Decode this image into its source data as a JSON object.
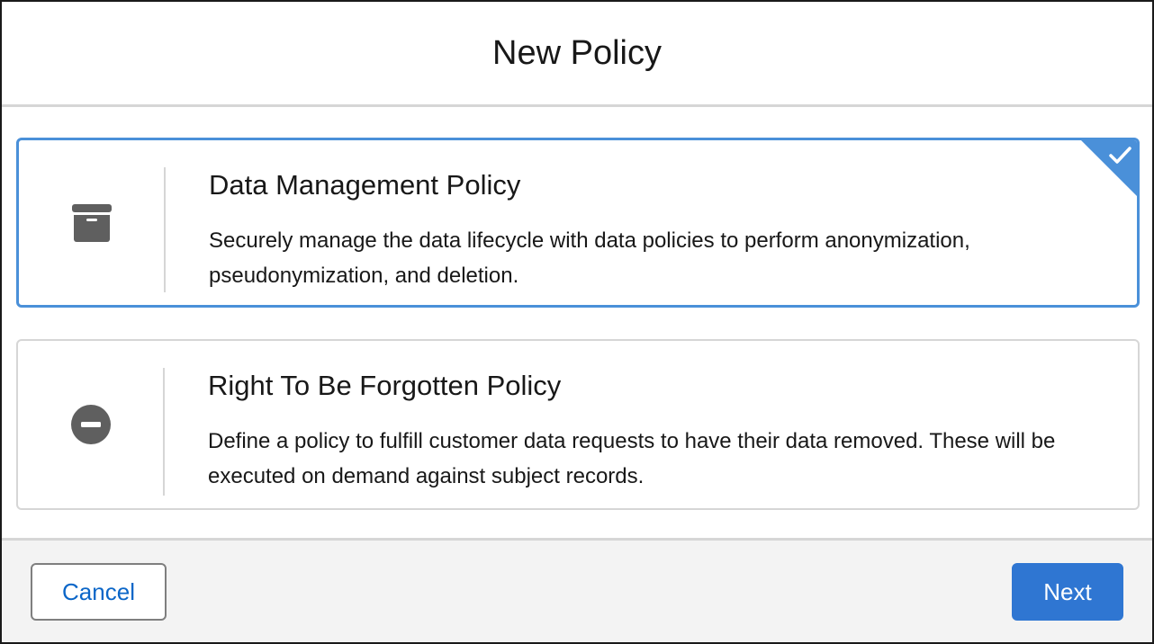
{
  "header": {
    "title": "New Policy"
  },
  "cards": [
    {
      "title": "Data Management Policy",
      "description": "Securely manage the data lifecycle with data policies to perform anonymization, pseudonymization, and deletion.",
      "icon": "archive-box-icon",
      "selected": true
    },
    {
      "title": "Right To Be Forgotten Policy",
      "description": "Define a policy to fulfill customer data requests to have their data removed. These will be executed on demand against subject records.",
      "icon": "minus-circle-icon",
      "selected": false
    }
  ],
  "footer": {
    "cancel_label": "Cancel",
    "next_label": "Next"
  },
  "colors": {
    "accent": "#2f76d2",
    "selected_border": "#4a90d9",
    "link_text": "#0b66c8",
    "icon_gray": "#5f5f5f",
    "footer_bg": "#f3f3f3"
  }
}
